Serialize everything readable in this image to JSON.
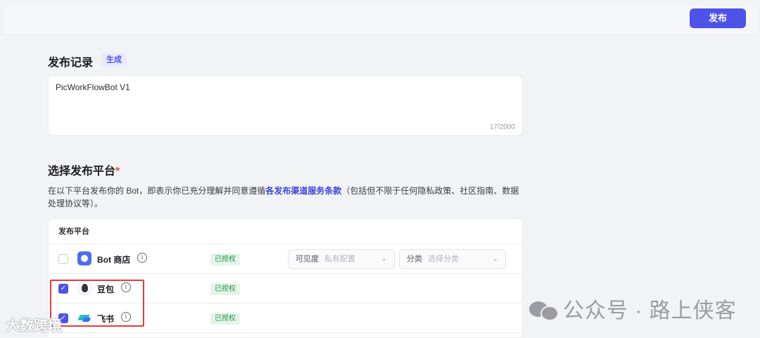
{
  "header": {
    "publish_label": "发布"
  },
  "record": {
    "title": "发布记录",
    "generate_tag": "生成",
    "textarea_value": "PicWorkFlowBot V1",
    "char_count": "17/2000"
  },
  "platforms": {
    "title": "选择发布平台",
    "required_mark": "*",
    "desc_prefix": "在以下平台发布你的 Bot，即表示你已充分理解并同意遵循",
    "desc_link": "各发布渠道服务条款",
    "desc_suffix": "（包括但不限于任何隐私政策、社区指南、数据处理协议等）。",
    "table_header": "发布平台",
    "rows": [
      {
        "name": "Bot 商店",
        "status": "已授权",
        "checked": false,
        "icon": "bot-store-icon",
        "visibility_label": "可见度",
        "visibility_value": "私有配置",
        "category_label": "分类",
        "category_placeholder": "选择分类"
      },
      {
        "name": "豆包",
        "status": "已授权",
        "checked": true,
        "icon": "doubao-icon"
      },
      {
        "name": "飞书",
        "status": "已授权",
        "checked": true,
        "icon": "feishu-icon"
      }
    ],
    "info_glyph": "i",
    "check_glyph": "✓",
    "dropdown_glyph": "⌄"
  },
  "watermarks": {
    "wechat": "公众号 · 路上侠客",
    "corner": "大数跨境"
  }
}
